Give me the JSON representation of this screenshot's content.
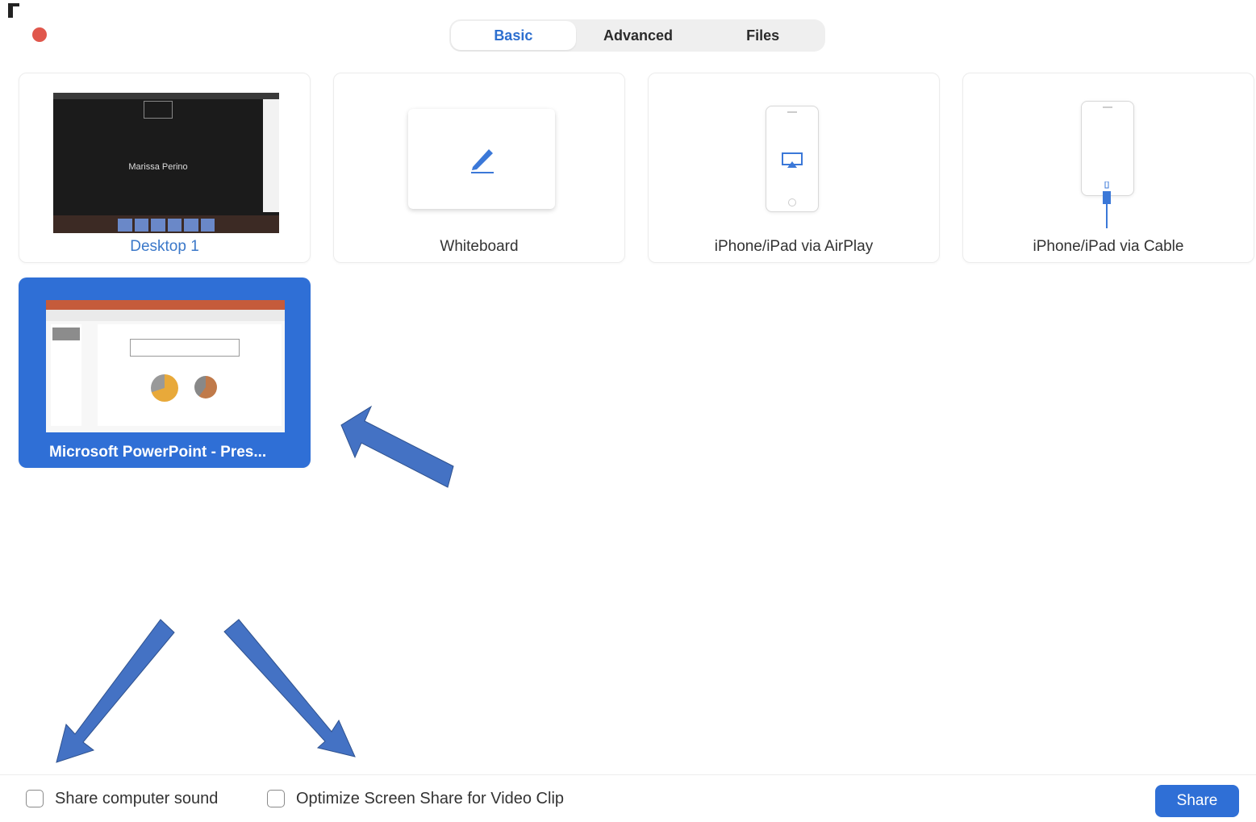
{
  "tabs": [
    {
      "label": "Basic",
      "active": true
    },
    {
      "label": "Advanced",
      "active": false
    },
    {
      "label": "Files",
      "active": false
    }
  ],
  "tiles": {
    "desktop": {
      "label": "Desktop 1",
      "preview_name": "Marissa Perino"
    },
    "whiteboard": {
      "label": "Whiteboard"
    },
    "airplay": {
      "label": "iPhone/iPad via AirPlay"
    },
    "cable": {
      "label": "iPhone/iPad via Cable"
    },
    "powerpoint": {
      "label": "Microsoft PowerPoint - Pres...",
      "selected": true
    }
  },
  "options": {
    "share_sound_label": "Share computer sound",
    "share_sound_checked": false,
    "optimize_label": "Optimize Screen Share for Video Clip",
    "optimize_checked": false
  },
  "share_button": "Share",
  "colors": {
    "accent": "#2f6fd6",
    "close": "#e0574c",
    "arrow": "#4472c4"
  },
  "icons": [
    "close-dot",
    "pencil-icon",
    "airplay-icon",
    "lightning-cable-icon",
    "arrow-icon"
  ]
}
